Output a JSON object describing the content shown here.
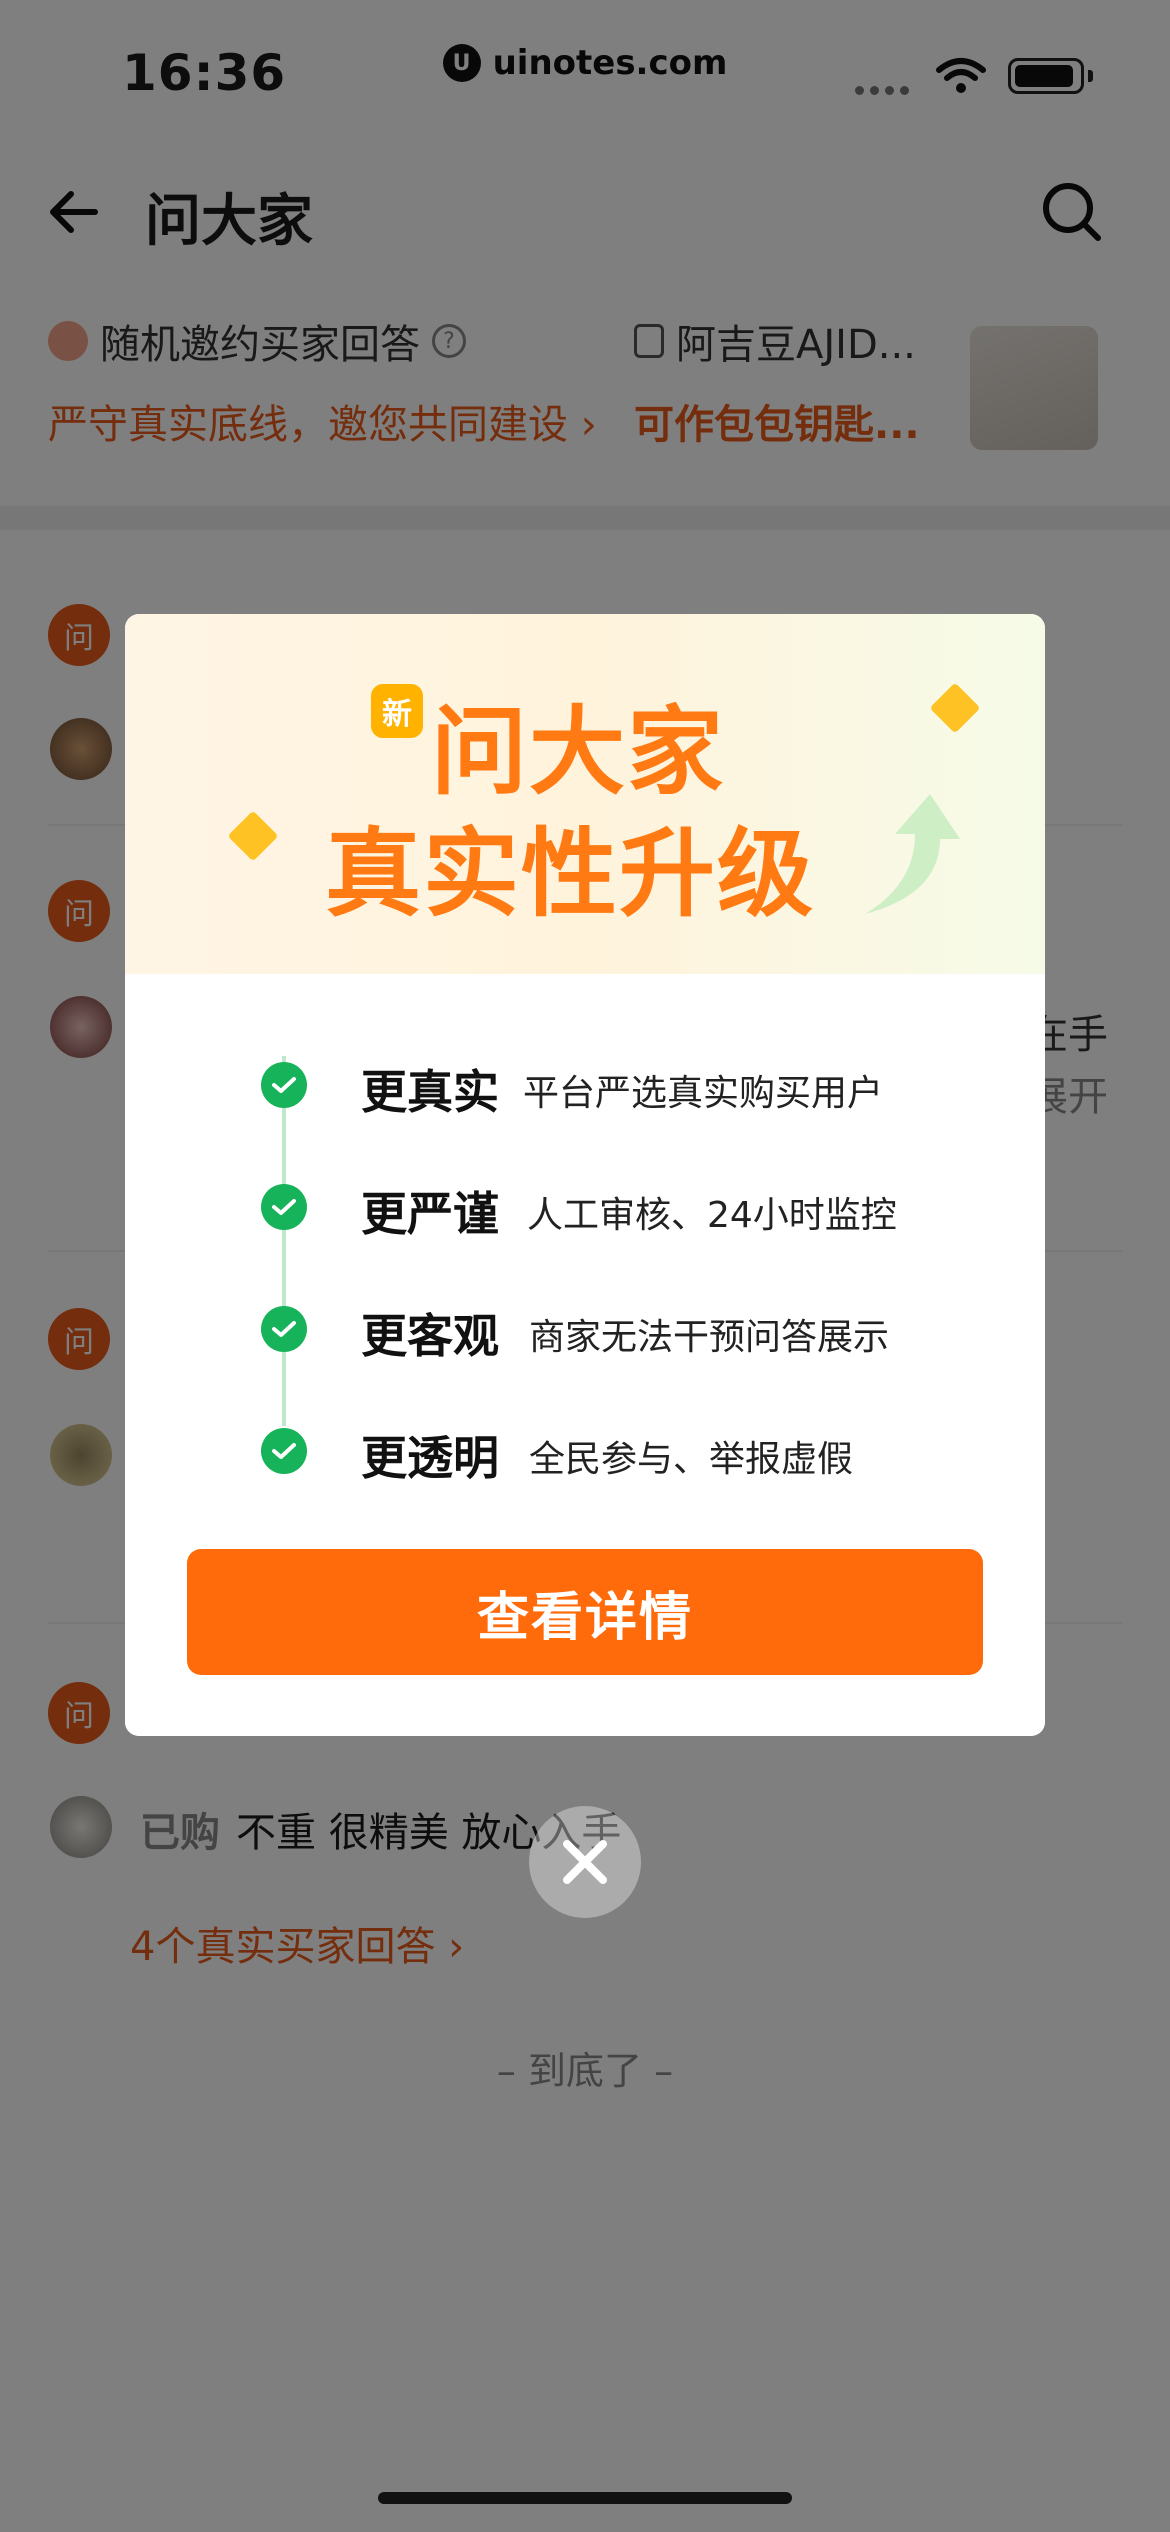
{
  "status_bar": {
    "time": "16:36",
    "watermark": "uinotes.com"
  },
  "header": {
    "title": "问大家"
  },
  "subheader": {
    "invite_label": "随机邀约买家回答",
    "invite_help": "?",
    "invite_desc": "严守真实底线，邀您共同建设",
    "invite_arrow": "›",
    "product_name": "阿吉豆AJID...",
    "product_desc": "可作包包钥匙..."
  },
  "questions": [
    {
      "badge": "问",
      "partial_text": ""
    },
    {
      "badge": "问",
      "partial_text_right_1": "在手",
      "partial_text_right_2": "展开"
    },
    {
      "badge": "问"
    },
    {
      "badge": "问",
      "bought_tag": "已购",
      "bought_text": "不重 很精美 放心入手",
      "answers_link": "4个真实买家回答 ›"
    }
  ],
  "footer": {
    "end_text": "– 到底了 –"
  },
  "modal": {
    "new_tag": "新",
    "title_line1": "问大家",
    "title_line2": "真实性升级",
    "features": [
      {
        "title": "更真实",
        "desc": "平台严选真实购买用户"
      },
      {
        "title": "更严谨",
        "desc": "人工审核、24小时监控"
      },
      {
        "title": "更客观",
        "desc": "商家无法干预问答展示"
      },
      {
        "title": "更透明",
        "desc": "全民参与、举报虚假"
      }
    ],
    "cta_label": "查看详情"
  },
  "colors": {
    "accent": "#ff6a0a",
    "link": "#e85a1b",
    "check": "#16b35a"
  }
}
